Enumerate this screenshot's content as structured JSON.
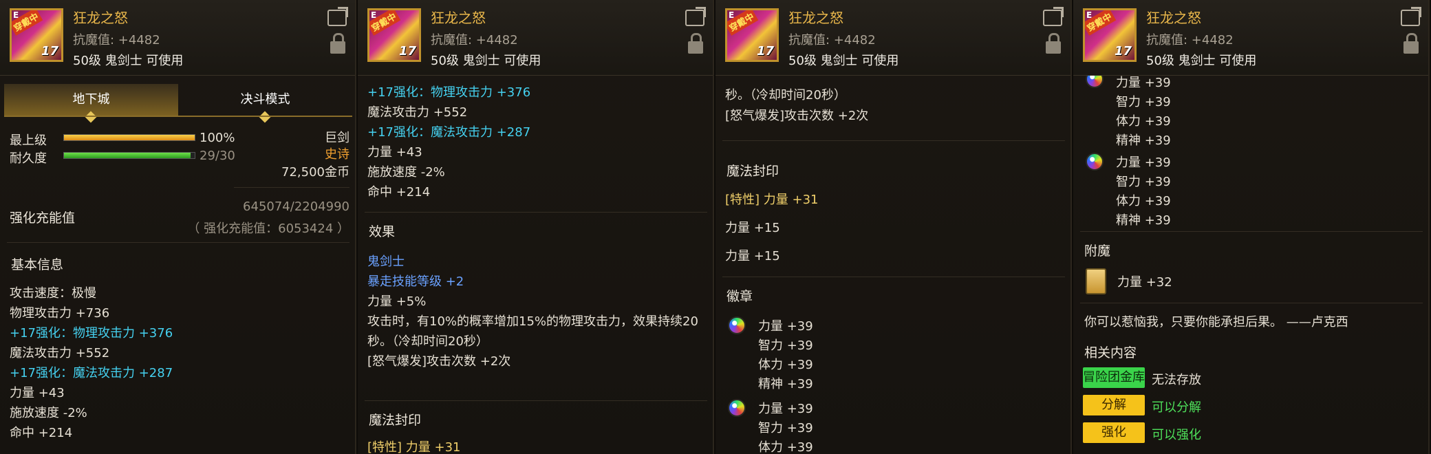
{
  "item": {
    "name": "狂龙之怒",
    "anti_magic": "抗魔值: +4482",
    "requirement": "50级 鬼剑士 可使用",
    "icon_badge": "穿戴中",
    "icon_level": "17",
    "icon_grade": "E"
  },
  "panel1": {
    "tabs": [
      "地下城",
      "决斗模式"
    ],
    "rarity_label": "最上级",
    "rarity_percent": "100%",
    "rarity_fill": 1.0,
    "durability_label": "耐久度",
    "durability_value": "29/30",
    "durability_fill": 0.967,
    "weapon_type": "巨剑",
    "grade": "史诗",
    "price": "72,500金币",
    "reinforce_label": "强化充能值",
    "reinforce_value": "645074/2204990",
    "reinforce_total": "（ 强化充能值：6053424 ）",
    "basic_info": "基本信息",
    "stats": [
      {
        "text": "攻击速度：极慢",
        "color": "w"
      },
      {
        "text": "物理攻击力 +736",
        "color": "w"
      },
      {
        "text": "+17强化：物理攻击力 +376",
        "color": "c"
      },
      {
        "text": "魔法攻击力 +552",
        "color": "w"
      },
      {
        "text": "+17强化：魔法攻击力 +287",
        "color": "c"
      },
      {
        "text": "力量 +43",
        "color": "w"
      },
      {
        "text": "施放速度 -2%",
        "color": "w"
      },
      {
        "text": "命中 +214",
        "color": "w"
      }
    ]
  },
  "panel2": {
    "top_lines": [
      {
        "text": "+17强化：物理攻击力 +376",
        "color": "c"
      },
      {
        "text": "魔法攻击力 +552",
        "color": "w"
      },
      {
        "text": "+17强化：魔法攻击力 +287",
        "color": "c"
      },
      {
        "text": "力量 +43",
        "color": "w"
      },
      {
        "text": "施放速度 -2%",
        "color": "w"
      },
      {
        "text": "命中 +214",
        "color": "w"
      }
    ],
    "effect_title": "效果",
    "effect_lines": [
      {
        "text": "鬼剑士",
        "color": "b"
      },
      {
        "text": "暴走技能等级 +2",
        "color": "b"
      },
      {
        "text": "力量 +5%",
        "color": "w"
      },
      {
        "text": "攻击时，有10%的概率增加15%的物理攻击力，效果持续20",
        "color": "w"
      },
      {
        "text": "秒。（冷却时间20秒）",
        "color": "w"
      },
      {
        "text": "[怒气爆发]攻击次数 +2次",
        "color": "w"
      }
    ],
    "seal_title": "魔法封印",
    "seal_partial": "[特性] 力量 +31"
  },
  "panel3": {
    "top_lines": [
      {
        "text": "秒。（冷却时间20秒）",
        "color": "w"
      },
      {
        "text": "[怒气爆发]攻击次数 +2次",
        "color": "w"
      }
    ],
    "seal_title": "魔法封印",
    "seal_lines": [
      {
        "text": "[特性] 力量 +31",
        "color": "y"
      },
      {
        "text": "力量 +15",
        "color": "w"
      },
      {
        "text": "力量 +15",
        "color": "w"
      }
    ],
    "emblem_title": "徽章",
    "emblem_group1": [
      "力量 +39",
      "智力 +39",
      "体力 +39",
      "精神 +39"
    ],
    "emblem_group2": [
      "力量 +39",
      "智力 +39",
      "体力 +39"
    ]
  },
  "panel4": {
    "emblem_group1": [
      "力量 +39",
      "智力 +39",
      "体力 +39",
      "精神 +39"
    ],
    "emblem_group2": [
      "力量 +39",
      "智力 +39",
      "体力 +39",
      "精神 +39"
    ],
    "enchant_title": "附魔",
    "enchant_value": "力量 +32",
    "flavor": "你可以惹恼我，只要你能承担后果。 ——卢克西",
    "related_title": "相关内容",
    "related": [
      {
        "button": "冒险团金库",
        "desc": "无法存放",
        "style": "green",
        "desc_color": "w"
      },
      {
        "button": "分解",
        "desc": "可以分解",
        "style": "yellow",
        "desc_color": "gr"
      },
      {
        "button": "强化",
        "desc": "可以强化",
        "style": "yellow",
        "desc_color": "gr"
      }
    ]
  }
}
